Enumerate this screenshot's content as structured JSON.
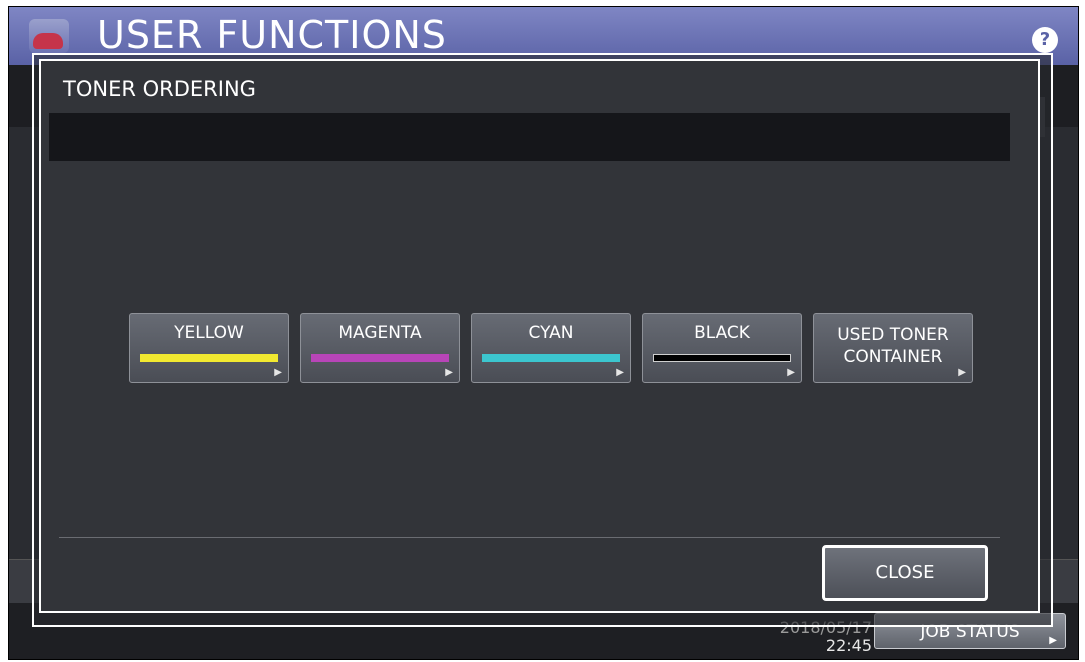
{
  "app": {
    "title": "USER FUNCTIONS",
    "help_label": "?"
  },
  "footer": {
    "date": "2018/05/17",
    "time": "22:45",
    "job_status_label": "JOB STATUS"
  },
  "dialog": {
    "title": "TONER ORDERING",
    "message": "",
    "buttons": [
      {
        "label": "YELLOW",
        "color": "#f2e930"
      },
      {
        "label": "MAGENTA",
        "color": "#b845b8"
      },
      {
        "label": "CYAN",
        "color": "#3cc6cf"
      },
      {
        "label": "BLACK",
        "color": "#000000"
      },
      {
        "label": "USED TONER",
        "label2": "CONTAINER"
      }
    ],
    "close_label": "CLOSE"
  },
  "icons": {
    "arrow": "▶",
    "app_icon": "toner-cartridge-icon"
  }
}
